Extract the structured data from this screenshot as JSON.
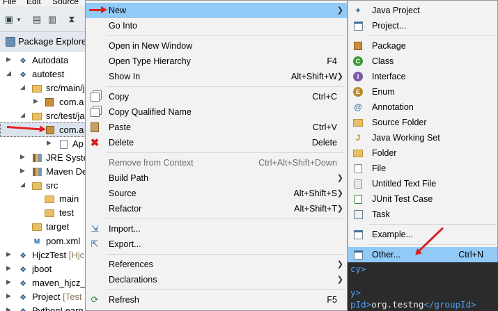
{
  "menubar": {
    "items": [
      "File",
      "Edit",
      "Source"
    ]
  },
  "explorer": {
    "title": "Package Explore",
    "rows": [
      {
        "label": "Autodata"
      },
      {
        "label": "autotest"
      },
      {
        "label": "src/main/j"
      },
      {
        "label": "com.a"
      },
      {
        "label": "src/test/ja"
      },
      {
        "label": "com.a"
      },
      {
        "label": "Ap"
      },
      {
        "label": "JRE Syste"
      },
      {
        "label": "Maven De"
      },
      {
        "label": "src"
      },
      {
        "label": "main"
      },
      {
        "label": "test"
      },
      {
        "label": "target"
      },
      {
        "label": "pom.xml"
      },
      {
        "label": "HjczTest",
        "dim": "[Hjc"
      },
      {
        "label": "jboot"
      },
      {
        "label": "maven_hjcz_t"
      },
      {
        "label": "Project",
        "dim": "[Test"
      },
      {
        "label": "PythonLearn"
      }
    ]
  },
  "context_menu": {
    "items": [
      {
        "label": "New",
        "has_submenu": true
      },
      {
        "label": "Go Into"
      },
      {
        "label": "Open in New Window"
      },
      {
        "label": "Open Type Hierarchy",
        "shortcut": "F4"
      },
      {
        "label": "Show In",
        "shortcut": "Alt+Shift+W",
        "has_submenu": true
      },
      {
        "label": "Copy",
        "shortcut": "Ctrl+C"
      },
      {
        "label": "Copy Qualified Name"
      },
      {
        "label": "Paste",
        "shortcut": "Ctrl+V"
      },
      {
        "label": "Delete",
        "shortcut": "Delete"
      },
      {
        "label": "Remove from Context",
        "shortcut": "Ctrl+Alt+Shift+Down",
        "disabled": true
      },
      {
        "label": "Build Path",
        "has_submenu": true
      },
      {
        "label": "Source",
        "shortcut": "Alt+Shift+S",
        "has_submenu": true
      },
      {
        "label": "Refactor",
        "shortcut": "Alt+Shift+T",
        "has_submenu": true
      },
      {
        "label": "Import..."
      },
      {
        "label": "Export..."
      },
      {
        "label": "References",
        "has_submenu": true
      },
      {
        "label": "Declarations",
        "has_submenu": true
      },
      {
        "label": "Refresh",
        "shortcut": "F5"
      }
    ]
  },
  "new_submenu": {
    "items": [
      {
        "label": "Java Project"
      },
      {
        "label": "Project..."
      },
      {
        "label": "Package"
      },
      {
        "label": "Class"
      },
      {
        "label": "Interface"
      },
      {
        "label": "Enum"
      },
      {
        "label": "Annotation"
      },
      {
        "label": "Source Folder"
      },
      {
        "label": "Java Working Set"
      },
      {
        "label": "Folder"
      },
      {
        "label": "File"
      },
      {
        "label": "Untitled Text File"
      },
      {
        "label": "JUnit Test Case"
      },
      {
        "label": "Task"
      },
      {
        "label": "Example..."
      },
      {
        "label": "Other...",
        "shortcut": "Ctrl+N"
      }
    ]
  },
  "editor": {
    "lines": [
      {
        "tag": "cy>"
      },
      {
        "tag": "y>"
      },
      {
        "open": "pId>",
        "text": "org.testng",
        "close": "</groupId>"
      }
    ]
  },
  "colors": {
    "highlight": "#91c9f7",
    "annotation_arrow": "#e02020",
    "editor_bg": "#2b2b2b"
  }
}
